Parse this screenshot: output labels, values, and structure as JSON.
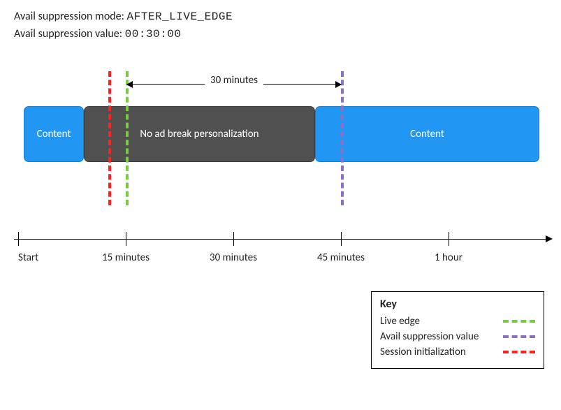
{
  "header": {
    "mode_label": "Avail suppression mode:",
    "mode_value": "AFTER_LIVE_EDGE",
    "value_label": "Avail suppression value:",
    "value_value": "00:30:00"
  },
  "bars": {
    "content1": "Content",
    "noads": "No ad break personalization",
    "content2": "Content"
  },
  "span": {
    "label": "30 minutes"
  },
  "markers": {
    "session_init_color": "#ff2222",
    "live_edge_color": "#7ac943",
    "avail_value_color": "#8a70c7"
  },
  "axis": {
    "ticks": [
      "Start",
      "15 minutes",
      "30 minutes",
      "45 minutes",
      "1 hour"
    ]
  },
  "legend": {
    "title": "Key",
    "items": [
      {
        "label": "Live edge"
      },
      {
        "label": "Avail suppression value"
      },
      {
        "label": "Session initialization"
      }
    ]
  }
}
